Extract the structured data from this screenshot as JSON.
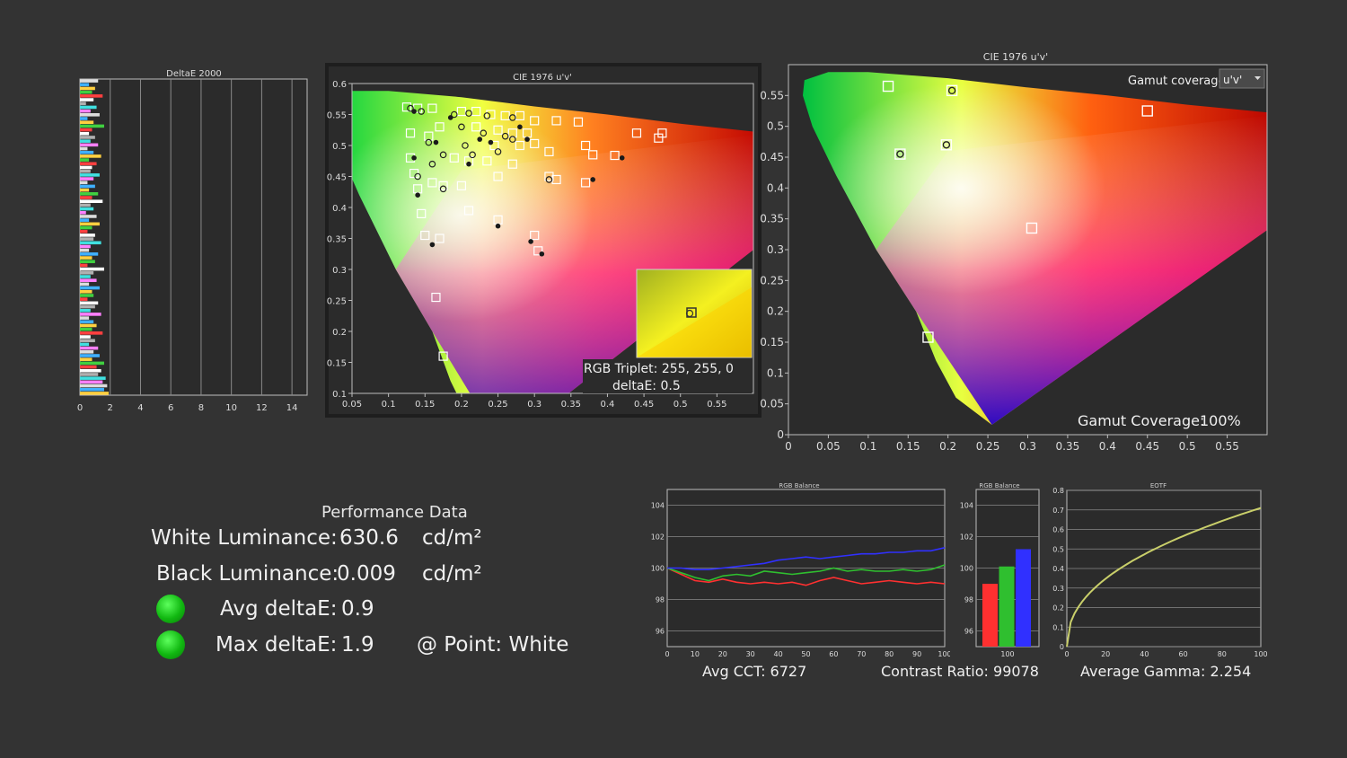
{
  "colors": {
    "background": "#333333",
    "plot_bg": "#2b2b2b",
    "red": "#ff3030",
    "green": "#2fbf2f",
    "blue": "#3030ff",
    "gamma": "#c9cf6a"
  },
  "deltae_chart": {
    "title": "DeltaE 2000",
    "xticks": [
      "0",
      "2",
      "4",
      "6",
      "8",
      "10",
      "12",
      "14"
    ],
    "xlim": [
      0,
      15
    ],
    "values": [
      1.2,
      0.6,
      1.0,
      0.8,
      1.5,
      0.9,
      0.4,
      1.1,
      0.7,
      1.3,
      0.5,
      0.9,
      1.6,
      0.8,
      0.6,
      1.0,
      0.7,
      1.2,
      0.5,
      0.9,
      1.4,
      0.6,
      1.1,
      0.8,
      0.7,
      1.3,
      0.9,
      0.5,
      1.0,
      0.6,
      1.2,
      0.8,
      1.5,
      0.7,
      0.9,
      0.4,
      1.1,
      0.6,
      1.3,
      0.8,
      0.5,
      1.0,
      0.9,
      1.4,
      0.7,
      0.6,
      1.2,
      0.8,
      1.0,
      0.5,
      1.6,
      0.9,
      0.7,
      1.1,
      0.6,
      1.3,
      0.8,
      0.9,
      0.5,
      1.2,
      1.0,
      0.7,
      1.4,
      0.6,
      0.9,
      1.1,
      0.8,
      1.5,
      0.7,
      1.0,
      0.6,
      1.2,
      0.9,
      1.3,
      0.8,
      1.6,
      1.1,
      1.4,
      1.2,
      1.7,
      1.5,
      1.8,
      1.6,
      1.9
    ]
  },
  "cie_small": {
    "title": "CIE 1976 u'v'",
    "xticks": [
      "0.05",
      "0.1",
      "0.15",
      "0.2",
      "0.25",
      "0.3",
      "0.35",
      "0.4",
      "0.45",
      "0.5",
      "0.55"
    ],
    "yticks": [
      "0.1",
      "0.15",
      "0.2",
      "0.25",
      "0.3",
      "0.35",
      "0.4",
      "0.45",
      "0.5",
      "0.55",
      "0.6"
    ],
    "xlim": [
      0.05,
      0.6
    ],
    "ylim": [
      0.1,
      0.6
    ],
    "inset_label_1": "RGB Triplet: 255, 255, 0",
    "inset_label_2": "deltaE: 0.5",
    "points": [
      [
        0.125,
        0.562
      ],
      [
        0.14,
        0.56
      ],
      [
        0.16,
        0.56
      ],
      [
        0.13,
        0.52
      ],
      [
        0.155,
        0.515
      ],
      [
        0.17,
        0.53
      ],
      [
        0.2,
        0.555
      ],
      [
        0.22,
        0.555
      ],
      [
        0.24,
        0.55
      ],
      [
        0.26,
        0.548
      ],
      [
        0.28,
        0.548
      ],
      [
        0.3,
        0.54
      ],
      [
        0.33,
        0.54
      ],
      [
        0.36,
        0.538
      ],
      [
        0.22,
        0.53
      ],
      [
        0.25,
        0.525
      ],
      [
        0.27,
        0.52
      ],
      [
        0.29,
        0.52
      ],
      [
        0.245,
        0.5
      ],
      [
        0.28,
        0.5
      ],
      [
        0.3,
        0.503
      ],
      [
        0.32,
        0.49
      ],
      [
        0.37,
        0.5
      ],
      [
        0.38,
        0.485
      ],
      [
        0.41,
        0.484
      ],
      [
        0.44,
        0.52
      ],
      [
        0.475,
        0.52
      ],
      [
        0.47,
        0.512
      ],
      [
        0.13,
        0.48
      ],
      [
        0.19,
        0.48
      ],
      [
        0.21,
        0.475
      ],
      [
        0.235,
        0.475
      ],
      [
        0.27,
        0.47
      ],
      [
        0.135,
        0.455
      ],
      [
        0.14,
        0.43
      ],
      [
        0.16,
        0.44
      ],
      [
        0.175,
        0.435
      ],
      [
        0.2,
        0.435
      ],
      [
        0.25,
        0.45
      ],
      [
        0.32,
        0.45
      ],
      [
        0.33,
        0.445
      ],
      [
        0.37,
        0.44
      ],
      [
        0.145,
        0.39
      ],
      [
        0.21,
        0.395
      ],
      [
        0.25,
        0.38
      ],
      [
        0.15,
        0.355
      ],
      [
        0.17,
        0.35
      ],
      [
        0.3,
        0.355
      ],
      [
        0.305,
        0.33
      ],
      [
        0.165,
        0.255
      ],
      [
        0.175,
        0.16
      ]
    ],
    "circles": [
      [
        0.13,
        0.56
      ],
      [
        0.145,
        0.555
      ],
      [
        0.19,
        0.55
      ],
      [
        0.21,
        0.552
      ],
      [
        0.235,
        0.548
      ],
      [
        0.27,
        0.545
      ],
      [
        0.2,
        0.53
      ],
      [
        0.23,
        0.52
      ],
      [
        0.26,
        0.515
      ],
      [
        0.205,
        0.5
      ],
      [
        0.25,
        0.49
      ],
      [
        0.175,
        0.485
      ],
      [
        0.215,
        0.485
      ],
      [
        0.16,
        0.47
      ],
      [
        0.155,
        0.505
      ],
      [
        0.14,
        0.45
      ],
      [
        0.175,
        0.43
      ],
      [
        0.32,
        0.445
      ],
      [
        0.27,
        0.51
      ]
    ],
    "dots": [
      [
        0.135,
        0.555
      ],
      [
        0.165,
        0.505
      ],
      [
        0.185,
        0.545
      ],
      [
        0.225,
        0.51
      ],
      [
        0.29,
        0.51
      ],
      [
        0.135,
        0.48
      ],
      [
        0.14,
        0.42
      ],
      [
        0.21,
        0.47
      ],
      [
        0.25,
        0.37
      ],
      [
        0.295,
        0.345
      ],
      [
        0.31,
        0.325
      ],
      [
        0.16,
        0.34
      ],
      [
        0.42,
        0.48
      ],
      [
        0.38,
        0.445
      ],
      [
        0.24,
        0.505
      ],
      [
        0.28,
        0.53
      ]
    ]
  },
  "cie_large": {
    "title": "CIE 1976 u'v'",
    "gamut_label": "Gamut coverage:",
    "gamut_select": "u'v'",
    "coverage_label": "Gamut Coverage:",
    "coverage_value": "100%",
    "xticks": [
      "0",
      "0.05",
      "0.1",
      "0.15",
      "0.2",
      "0.25",
      "0.3",
      "0.35",
      "0.4",
      "0.45",
      "0.5",
      "0.55"
    ],
    "yticks": [
      "0",
      "0.05",
      "0.1",
      "0.15",
      "0.2",
      "0.25",
      "0.3",
      "0.35",
      "0.4",
      "0.45",
      "0.5",
      "0.55"
    ],
    "xlim": [
      0,
      0.6
    ],
    "ylim": [
      0,
      0.6
    ],
    "targets": [
      [
        0.125,
        0.565
      ],
      [
        0.205,
        0.558
      ],
      [
        0.45,
        0.525
      ],
      [
        0.14,
        0.455
      ],
      [
        0.198,
        0.47
      ],
      [
        0.305,
        0.335
      ],
      [
        0.175,
        0.158
      ]
    ],
    "measured": [
      [
        0.205,
        0.558
      ],
      [
        0.14,
        0.455
      ],
      [
        0.198,
        0.47
      ]
    ]
  },
  "performance": {
    "title": "Performance Data",
    "white_label": "White Luminance:",
    "white_value": "630.6",
    "white_unit": "cd/m²",
    "black_label": "Black Luminance:",
    "black_value": "0.009",
    "black_unit": "cd/m²",
    "avg_label": "Avg deltaE:",
    "avg_value": "0.9",
    "max_label": "Max deltaE:",
    "max_value": "1.9",
    "point_label": "@ Point: White"
  },
  "rgb_balance_line": {
    "title": "RGB Balance",
    "xticks": [
      "0",
      "10",
      "20",
      "30",
      "40",
      "50",
      "60",
      "70",
      "80",
      "90",
      "100"
    ],
    "yticks": [
      "96",
      "98",
      "100",
      "102",
      "104"
    ],
    "ylim": [
      95,
      105
    ],
    "x": [
      0,
      5,
      10,
      15,
      20,
      25,
      30,
      35,
      40,
      45,
      50,
      55,
      60,
      65,
      70,
      75,
      80,
      85,
      90,
      95,
      100
    ],
    "series": [
      {
        "color": "red",
        "values": [
          100,
          99.6,
          99.2,
          99.1,
          99.3,
          99.1,
          99.0,
          99.1,
          99.0,
          99.1,
          98.9,
          99.2,
          99.4,
          99.2,
          99.0,
          99.1,
          99.2,
          99.1,
          99.0,
          99.1,
          99.0
        ]
      },
      {
        "color": "green",
        "values": [
          100,
          99.7,
          99.4,
          99.2,
          99.5,
          99.6,
          99.5,
          99.8,
          99.7,
          99.6,
          99.7,
          99.8,
          100.0,
          99.8,
          99.9,
          99.8,
          99.8,
          99.9,
          99.8,
          99.9,
          100.2
        ]
      },
      {
        "color": "blue",
        "values": [
          100,
          100.0,
          99.9,
          99.9,
          100.0,
          100.1,
          100.2,
          100.3,
          100.5,
          100.6,
          100.7,
          100.6,
          100.7,
          100.8,
          100.9,
          100.9,
          101.0,
          101.0,
          101.1,
          101.1,
          101.3
        ]
      }
    ],
    "footer": "Avg CCT: 6727"
  },
  "rgb_balance_bar": {
    "title": "RGB Balance",
    "yticks": [
      "96",
      "98",
      "100",
      "102",
      "104"
    ],
    "ylim": [
      95,
      105
    ],
    "xtick": "100",
    "values": [
      {
        "color": "red",
        "value": 99.0
      },
      {
        "color": "green",
        "value": 100.1
      },
      {
        "color": "blue",
        "value": 101.2
      }
    ],
    "footer": "Contrast Ratio: 99078"
  },
  "eotf": {
    "title": "EOTF",
    "xticks": [
      "0",
      "20",
      "40",
      "60",
      "80",
      "100"
    ],
    "yticks": [
      "0",
      "0.1",
      "0.2",
      "0.3",
      "0.4",
      "0.5",
      "0.6",
      "0.7",
      "0.8"
    ],
    "ylim": [
      0,
      0.8
    ],
    "gamma": 2.254,
    "footer": "Average Gamma: 2.254"
  }
}
